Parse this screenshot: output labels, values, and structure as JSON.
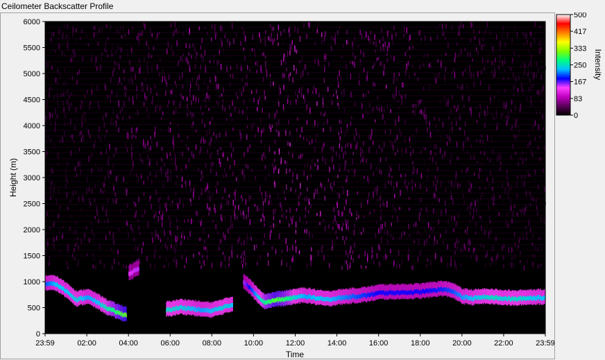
{
  "window": {
    "title": "Ceilometer Backscatter Profile"
  },
  "chart_data": {
    "type": "heatmap",
    "title": "",
    "xlabel": "Time",
    "ylabel": "Height (m)",
    "colorbar_label": "Intensity",
    "x_ticks": [
      "23:59",
      "02:00",
      "04:00",
      "06:00",
      "08:00",
      "10:00",
      "12:00",
      "14:00",
      "16:00",
      "18:00",
      "20:00",
      "22:00",
      "23:59"
    ],
    "y_ticks": [
      0,
      500,
      1000,
      1500,
      2000,
      2500,
      3000,
      3500,
      4000,
      4500,
      5000,
      5500,
      6000
    ],
    "ylim": [
      0,
      6000
    ],
    "colorbar_ticks": [
      0,
      83,
      167,
      250,
      333,
      417,
      500
    ],
    "colorbar_range": [
      0,
      500
    ],
    "colormap": [
      "#000000",
      "#5a005a",
      "#c000c0",
      "#ff40ff",
      "#0000ff",
      "#00c0ff",
      "#00ff80",
      "#80ff00",
      "#ffff00",
      "#ff8000",
      "#ff0000",
      "#ffffff"
    ],
    "background_noise_level": 40,
    "cloud_layer": [
      {
        "t": 0.0,
        "h": 960,
        "i": 200
      },
      {
        "t": 0.5,
        "h": 950,
        "i": 230
      },
      {
        "t": 1.0,
        "h": 820,
        "i": 230
      },
      {
        "t": 1.5,
        "h": 650,
        "i": 240
      },
      {
        "t": 2.0,
        "h": 700,
        "i": 220
      },
      {
        "t": 2.5,
        "h": 600,
        "i": 230
      },
      {
        "t": 3.0,
        "h": 480,
        "i": 260
      },
      {
        "t": 3.5,
        "h": 400,
        "i": 290
      },
      {
        "t": 3.9,
        "h": 350,
        "i": 310
      },
      {
        "t": 4.0,
        "h": 1150,
        "i": 140
      },
      {
        "t": 4.5,
        "h": 1250,
        "i": 150
      },
      {
        "t": 5.8,
        "h": 450,
        "i": 250
      },
      {
        "t": 6.5,
        "h": 500,
        "i": 240
      },
      {
        "t": 7.0,
        "h": 480,
        "i": 230
      },
      {
        "t": 7.5,
        "h": 450,
        "i": 220
      },
      {
        "t": 8.0,
        "h": 440,
        "i": 230
      },
      {
        "t": 8.5,
        "h": 500,
        "i": 240
      },
      {
        "t": 9.0,
        "h": 560,
        "i": 230
      },
      {
        "t": 9.5,
        "h": 1000,
        "i": 150
      },
      {
        "t": 10.5,
        "h": 600,
        "i": 270
      },
      {
        "t": 11.0,
        "h": 640,
        "i": 300
      },
      {
        "t": 11.5,
        "h": 660,
        "i": 280
      },
      {
        "t": 12.0,
        "h": 700,
        "i": 240
      },
      {
        "t": 12.5,
        "h": 720,
        "i": 220
      },
      {
        "t": 13.0,
        "h": 680,
        "i": 230
      },
      {
        "t": 13.5,
        "h": 650,
        "i": 230
      },
      {
        "t": 14.0,
        "h": 680,
        "i": 220
      },
      {
        "t": 14.5,
        "h": 700,
        "i": 210
      },
      {
        "t": 15.0,
        "h": 720,
        "i": 200
      },
      {
        "t": 15.5,
        "h": 740,
        "i": 190
      },
      {
        "t": 16.0,
        "h": 780,
        "i": 180
      },
      {
        "t": 17.0,
        "h": 790,
        "i": 180
      },
      {
        "t": 18.0,
        "h": 800,
        "i": 180
      },
      {
        "t": 19.0,
        "h": 850,
        "i": 190
      },
      {
        "t": 19.5,
        "h": 820,
        "i": 200
      },
      {
        "t": 20.0,
        "h": 700,
        "i": 220
      },
      {
        "t": 20.5,
        "h": 680,
        "i": 230
      },
      {
        "t": 21.0,
        "h": 700,
        "i": 240
      },
      {
        "t": 21.5,
        "h": 690,
        "i": 250
      },
      {
        "t": 22.0,
        "h": 680,
        "i": 240
      },
      {
        "t": 22.5,
        "h": 660,
        "i": 250
      },
      {
        "t": 23.0,
        "h": 680,
        "i": 240
      },
      {
        "t": 23.5,
        "h": 690,
        "i": 230
      },
      {
        "t": 24.0,
        "h": 680,
        "i": 230
      }
    ]
  }
}
